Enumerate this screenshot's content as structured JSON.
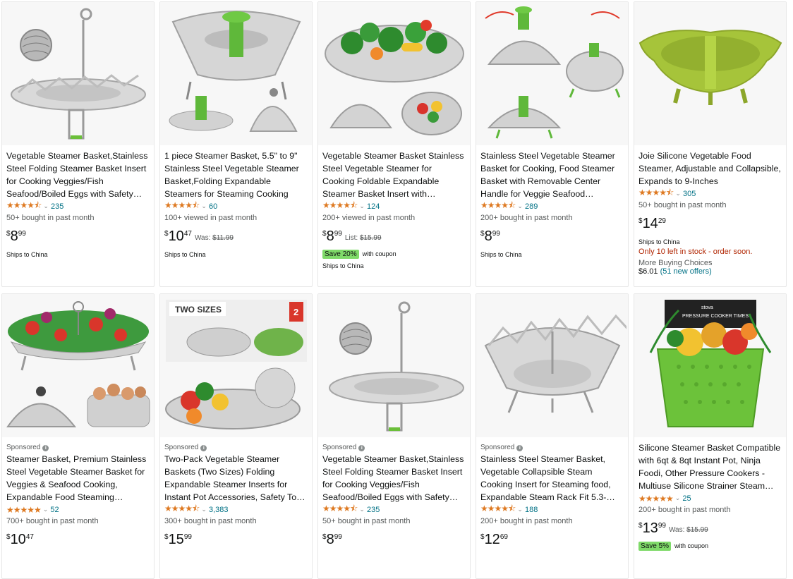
{
  "products": [
    {
      "title": "Vegetable Steamer Basket,Stainless Steel Folding Steamer Basket Insert for Cooking Veggies/Fish Seafood/Boiled Eggs with Safety…",
      "stars": "★★★★⯪",
      "rating_count": "235",
      "bought": "50+ bought in past month",
      "price": {
        "symbol": "$",
        "whole": "8",
        "fraction": "99"
      },
      "ships": "Ships to China",
      "rating_value": 4.5
    },
    {
      "title": "1 piece Steamer Basket, 5.5\" to 9\" Stainless Steel Vegetable Steamer Basket,Folding Expandable Steamers for Steaming Cooking",
      "stars": "★★★★⯪",
      "rating_count": "60",
      "bought": "100+ viewed in past month",
      "price": {
        "symbol": "$",
        "whole": "10",
        "fraction": "47"
      },
      "was_label": "Was:",
      "was_price": "$11.99",
      "ships": "Ships to China",
      "rating_value": 4.5
    },
    {
      "title": "Vegetable Steamer Basket Stainless Steel Vegetable Steamer for Cooking Foldable Expandable Steamer Basket Insert with Removable Center Hand…",
      "stars": "★★★★⯪",
      "rating_count": "124",
      "bought": "200+ viewed in past month",
      "price": {
        "symbol": "$",
        "whole": "8",
        "fraction": "99"
      },
      "was_label": "List:",
      "was_price": "$15.99",
      "coupon_badge": "Save 20%",
      "coupon_text": "with coupon",
      "ships": "Ships to China",
      "rating_value": 4.5
    },
    {
      "title": "Stainless Steel Vegetable Steamer Basket for Cooking, Food Steamer Basket with Removable Center Handle for Veggie Seafood Cooking…",
      "stars": "★★★★⯪",
      "rating_count": "289",
      "bought": "200+ bought in past month",
      "price": {
        "symbol": "$",
        "whole": "8",
        "fraction": "99"
      },
      "ships": "Ships to China",
      "rating_value": 4.5
    },
    {
      "title": "Joie Silicone Vegetable Food Steamer, Adjustable and Collapsible, Expands to 9-Inches",
      "stars": "★★★★⯪",
      "rating_count": "305",
      "bought": "50+ bought in past month",
      "price": {
        "symbol": "$",
        "whole": "14",
        "fraction": "29"
      },
      "ships": "Ships to China",
      "stock": "Only 10 left in stock - order soon.",
      "more_buying": "More Buying Choices",
      "offers_price": "$6.01",
      "offers_link": "(51 new offers)",
      "rating_value": 4.5
    },
    {
      "sponsored": "Sponsored",
      "title": "Steamer Basket, Premium Stainless Steel Vegetable Steamer Basket for Veggies & Seafood Cooking, Expandable Food Steaming Basket…",
      "stars": "★★★★★",
      "rating_count": "52",
      "bought": "700+ bought in past month",
      "price": {
        "symbol": "$",
        "whole": "10",
        "fraction": "47"
      },
      "rating_value": 5
    },
    {
      "sponsored": "Sponsored",
      "title": "Two-Pack Vegetable Steamer Baskets (Two Sizes) Folding Expandable Steamer Inserts for Instant Pot Accessories, Safety Tool, Stainless…",
      "stars": "★★★★⯪",
      "rating_count": "3,383",
      "bought": "300+ bought in past month",
      "price": {
        "symbol": "$",
        "whole": "15",
        "fraction": "99"
      },
      "image_text": {
        "two_sizes": "TWO SIZES",
        "count": "2"
      },
      "rating_value": 4.5
    },
    {
      "sponsored": "Sponsored",
      "title": "Vegetable Steamer Basket,Stainless Steel Folding Steamer Basket Insert for Cooking Veggies/Fish Seafood/Boiled Eggs with Safety…",
      "stars": "★★★★⯪",
      "rating_count": "235",
      "bought": "50+ bought in past month",
      "price": {
        "symbol": "$",
        "whole": "8",
        "fraction": "99"
      },
      "rating_value": 4.5
    },
    {
      "sponsored": "Sponsored",
      "title": "Stainless Steel Steamer Basket, Vegetable Collapsible Steam Cooking Insert for Steaming food, Expandable Steam Rack Fit 5.3-10inch Instant…",
      "stars": "★★★★⯪",
      "rating_count": "188",
      "bought": "200+ bought in past month",
      "price": {
        "symbol": "$",
        "whole": "12",
        "fraction": "69"
      },
      "rating_value": 4.5
    },
    {
      "title": "Silicone Steamer Basket Compatible with 6qt & 8qt Instant Pot, Ninja Foodi, Other Pressure Cookers - Multiuse Silicone Strainer Steam…",
      "stars": "★★★★★",
      "rating_count": "25",
      "bought": "200+ bought in past month",
      "price": {
        "symbol": "$",
        "whole": "13",
        "fraction": "99"
      },
      "was_label": "Was:",
      "was_price": "$15.99",
      "coupon_badge": "Save 5%",
      "coupon_text": "with coupon",
      "image_text": {
        "brand": "stova",
        "banner": "PRESSURE COOKER TIMES"
      },
      "rating_value": 5
    }
  ],
  "colors": {
    "star": "#DE7921",
    "link": "#007185",
    "coupon": "#7FDA69",
    "stock": "#B12704"
  }
}
